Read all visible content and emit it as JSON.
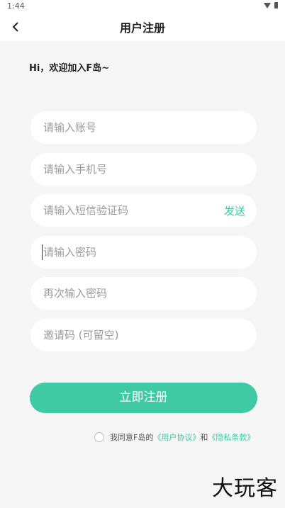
{
  "status": {
    "time": "1:44"
  },
  "header": {
    "title": "用户注册"
  },
  "welcome": "Hi，欢迎加入F岛~",
  "form": {
    "account_placeholder": "请输入账号",
    "phone_placeholder": "请输入手机号",
    "sms_placeholder": "请输入短信验证码",
    "send_label": "发送",
    "password_placeholder": "请输入密码",
    "password_confirm_placeholder": "再次输入密码",
    "invite_placeholder": "邀请码 (可留空)"
  },
  "submit_label": "立即注册",
  "agreement": {
    "prefix": "我同意F岛的",
    "user_agreement": "《用户协议》",
    "and": "和",
    "privacy_policy": "《隐私条款》"
  },
  "watermark": "大玩客",
  "colors": {
    "accent": "#3fcaa4",
    "background": "#f6f6f6"
  }
}
